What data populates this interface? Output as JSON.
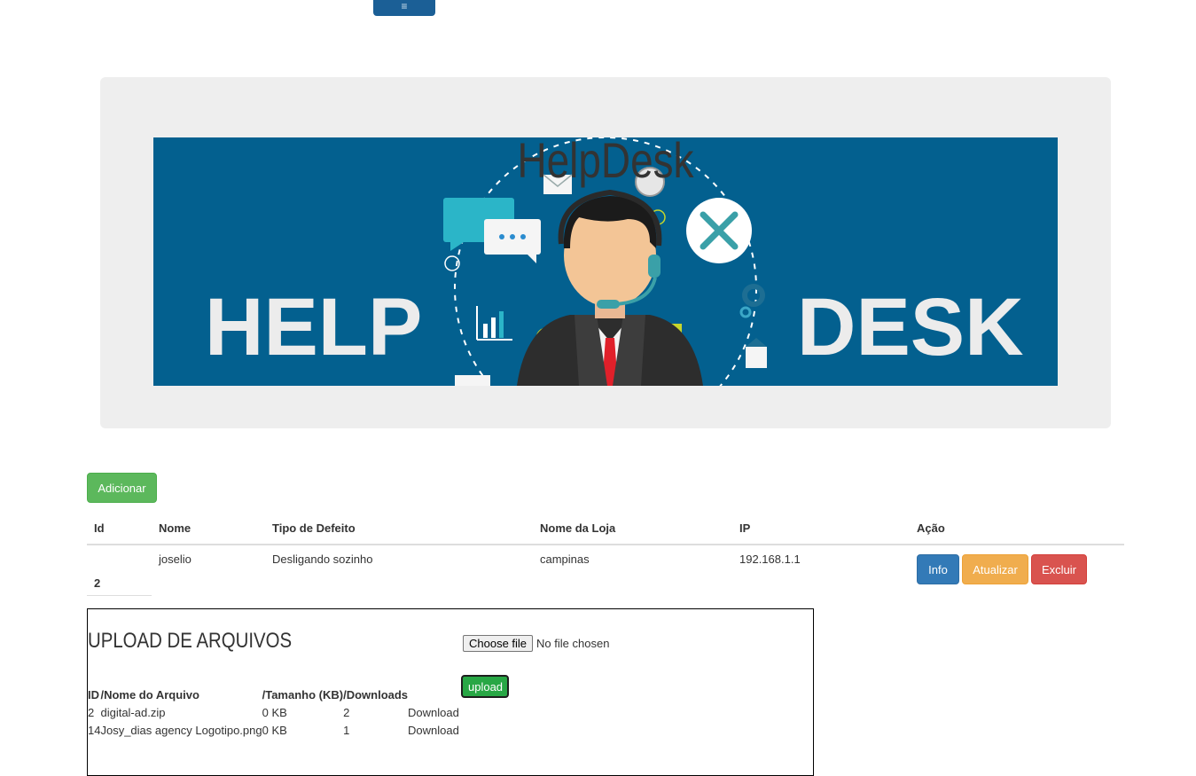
{
  "nav": {
    "toggle_icon": "≡"
  },
  "hero": {
    "title": "HelpDesk",
    "banner_left_word": "HELP",
    "banner_right_word": "DESK",
    "banner_bg": "#03608f"
  },
  "actions": {
    "add_label": "Adicionar"
  },
  "table": {
    "headers": [
      "Id",
      "Nome",
      "Tipo de Defeito",
      "Nome da Loja",
      "IP",
      "Ação"
    ],
    "rows": [
      {
        "id": "2",
        "nome": "joselio",
        "tipo": "Desligando sozinho",
        "loja": "campinas",
        "ip": "192.168.1.1"
      }
    ],
    "row_actions": {
      "info": "Info",
      "update": "Atualizar",
      "delete": "Excluir"
    }
  },
  "upload": {
    "title": "UPLOAD DE ARQUIVOS",
    "choose_label": "Choose file",
    "no_file_label": "No file chosen",
    "upload_button": "upload",
    "headers": [
      "ID",
      "/Nome do Arquivo",
      "/Tamanho (KB)",
      "/Downloads"
    ],
    "files": [
      {
        "id": "2",
        "name": "digital-ad.zip",
        "size": "0 KB",
        "downloads": "2",
        "link": "Download"
      },
      {
        "id": "14",
        "name": "Josy_dias agency Logotipo.png",
        "size": "0 KB",
        "downloads": "1",
        "link": "Download"
      }
    ]
  },
  "colors": {
    "success": "#5cb85c",
    "primary": "#337ab7",
    "warning": "#f0ad4e",
    "danger": "#d9534f",
    "upload": "#28a745"
  }
}
